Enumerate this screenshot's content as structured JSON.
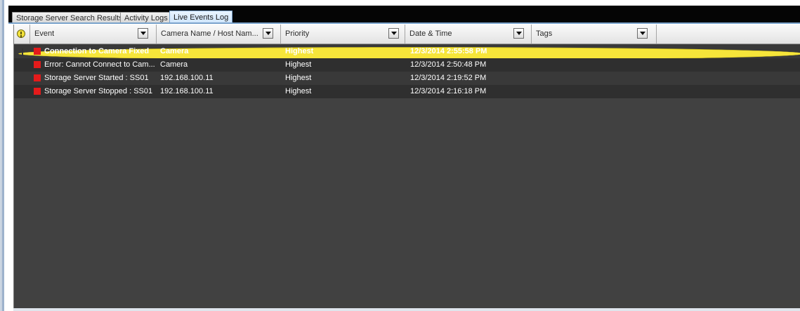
{
  "tabs": [
    {
      "label": "Storage Server Search Results",
      "active": false
    },
    {
      "label": "Activity Logs",
      "active": false
    },
    {
      "label": "Live Events Log",
      "active": true
    }
  ],
  "columns": {
    "event": "Event",
    "camera": "Camera Name / Host Nam...",
    "priority": "Priority",
    "datetime": "Date & Time",
    "tags": "Tags"
  },
  "header_icon": "warning-icon",
  "rows": [
    {
      "warning": true,
      "bold": true,
      "severity": "red-square-icon",
      "event": "Connection to Camera Fixed",
      "camera": "Camera",
      "priority": "Highest",
      "datetime": "12/3/2014 2:55:58 PM",
      "tags": ""
    },
    {
      "warning": false,
      "bold": false,
      "severity": "red-square-icon",
      "event": "Error: Cannot Connect to Cam...",
      "camera": "Camera",
      "priority": "Highest",
      "datetime": "12/3/2014 2:50:48 PM",
      "tags": ""
    },
    {
      "warning": false,
      "bold": false,
      "severity": "red-square-icon",
      "event": "Storage Server Started : SS01",
      "camera": "192.168.100.11",
      "priority": "Highest",
      "datetime": "12/3/2014 2:19:52 PM",
      "tags": ""
    },
    {
      "warning": false,
      "bold": false,
      "severity": "red-square-icon",
      "event": "Storage Server Stopped : SS01",
      "camera": "192.168.100.11",
      "priority": "Highest",
      "datetime": "12/3/2014 2:16:18 PM",
      "tags": ""
    }
  ],
  "colors": {
    "grid_background": "#414141",
    "severity_red": "#e41b1b",
    "warning_yellow": "#f6e53a",
    "active_tab": "#cde4fb"
  }
}
